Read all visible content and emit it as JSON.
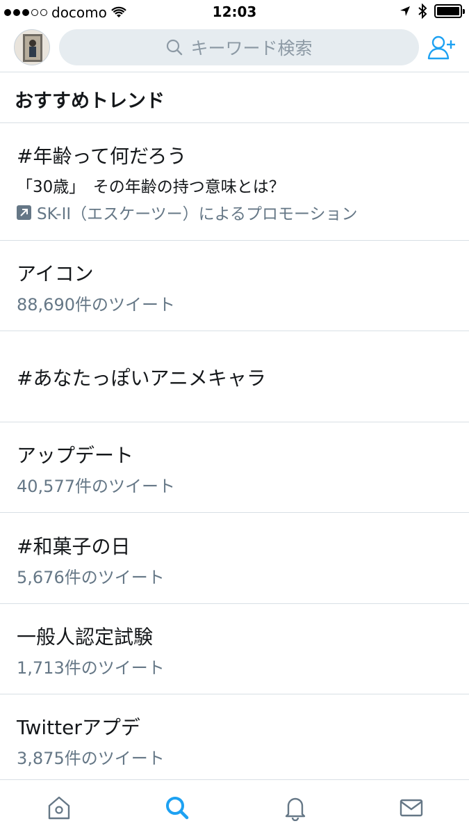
{
  "status_bar": {
    "carrier": "docomo",
    "time": "12:03"
  },
  "search": {
    "placeholder": "キーワード検索"
  },
  "section": {
    "title": "おすすめトレンド"
  },
  "trends": [
    {
      "name": "#年齢って何だろう",
      "description": "「30歳」　その年齢の持つ意味とは？",
      "promoted": "SK-II（エスケーツー）によるプロモーション"
    },
    {
      "name": "アイコン",
      "tweets": "88,690件のツイート"
    },
    {
      "name": "#あなたっぽいアニメキャラ"
    },
    {
      "name": "アップデート",
      "tweets": "40,577件のツイート"
    },
    {
      "name": "#和菓子の日",
      "tweets": "5,676件のツイート"
    },
    {
      "name": "一般人認定試験",
      "tweets": "1,713件のツイート"
    },
    {
      "name": "Twitterアプデ",
      "tweets": "3,875件のツイート"
    }
  ],
  "tabbar": {
    "items": [
      "home-icon",
      "search-icon",
      "notifications-icon",
      "messages-icon"
    ],
    "active_color": "#1da1f2",
    "inactive_color": "#657786"
  },
  "colors": {
    "accent": "#1da1f2",
    "divider": "#d8dfe5",
    "secondary_text": "#657786"
  }
}
